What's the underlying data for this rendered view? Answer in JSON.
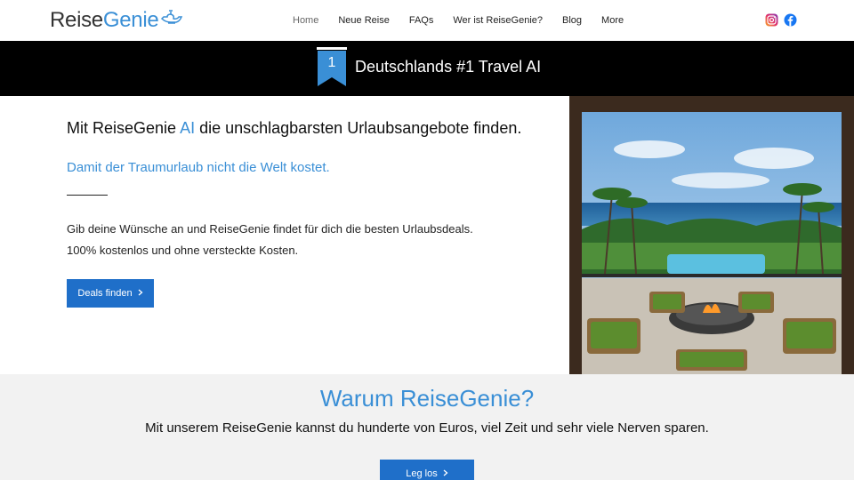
{
  "header": {
    "logo_part1": "Reise",
    "logo_part2": "Genie",
    "nav": [
      {
        "label": "Home",
        "active": true
      },
      {
        "label": "Neue Reise"
      },
      {
        "label": "FAQs"
      },
      {
        "label": "Wer ist ReiseGenie?"
      },
      {
        "label": "Blog"
      },
      {
        "label": "More"
      }
    ],
    "social_icons": [
      "instagram-icon",
      "facebook-icon"
    ]
  },
  "banner": {
    "badge_number": "1",
    "text": "Deutschlands #1 Travel AI"
  },
  "hero": {
    "headline_pre": "Mit ReiseGenie ",
    "headline_accent": "AI",
    "headline_post": " die unschlagbarsten Urlaubsangebote finden.",
    "subheadline": "Damit der Traumurlaub nicht die Welt kostet.",
    "body_line1": "Gib deine Wünsche an und ReiseGenie findet für dich die besten Urlaubsdeals.",
    "body_line2": "100% kostenlos und ohne versteckte Kosten.",
    "cta_label": "Deals finden"
  },
  "why": {
    "title": "Warum ReiseGenie?",
    "text": "Mit unserem ReiseGenie kannst du hunderte von Euros, viel Zeit und sehr viele Nerven sparen.",
    "cta_label": "Leg los"
  },
  "colors": {
    "accent": "#3a8fd6",
    "button": "#1f6fc9",
    "banner_bg": "#000000",
    "section_bg": "#f2f2f2"
  }
}
